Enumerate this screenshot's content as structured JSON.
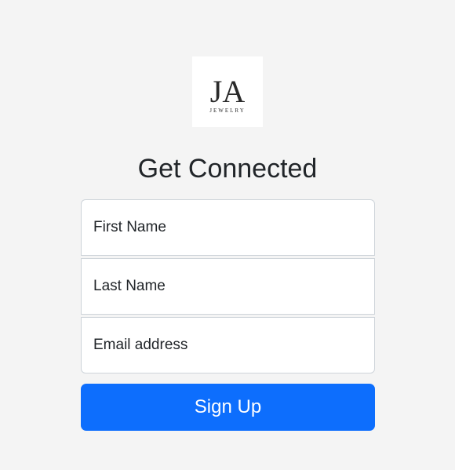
{
  "logo": {
    "monogram": "JA",
    "wordmark": "JEWELRY"
  },
  "page": {
    "title": "Get Connected"
  },
  "form": {
    "first_name": {
      "placeholder": "First Name",
      "value": ""
    },
    "last_name": {
      "placeholder": "Last Name",
      "value": ""
    },
    "email": {
      "placeholder": "Email address",
      "value": ""
    },
    "submit_label": "Sign Up"
  },
  "colors": {
    "background": "#f4f4f4",
    "primary": "#0d6efd",
    "text": "#212529",
    "border": "#ced4da"
  }
}
